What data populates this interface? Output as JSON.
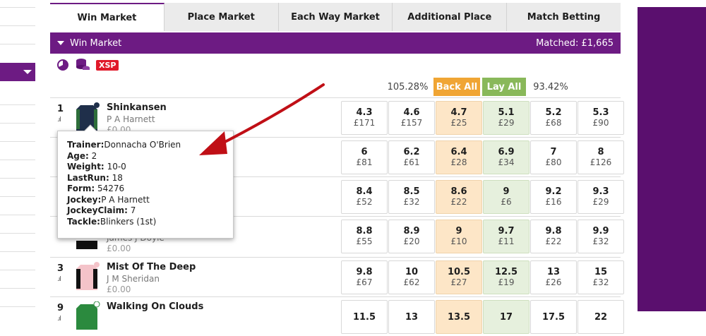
{
  "tabs": [
    "Win Market",
    "Place Market",
    "Each Way Market",
    "Additional Place",
    "Match Betting"
  ],
  "market": {
    "name": "Win Market",
    "matched": "Matched: £1,665"
  },
  "tools": {
    "xsp": "XSP"
  },
  "header": {
    "back_pct": "105.28%",
    "back_all": "Back All",
    "lay_all": "Lay All",
    "lay_pct": "93.42%"
  },
  "colors": {
    "brand": "#6d1b83",
    "back": "#f0a534",
    "lay": "#89b85a",
    "back_cell": "#fde6c7",
    "lay_cell": "#e6f0dd"
  },
  "runners": [
    {
      "num": "1",
      "name": "Shinkansen",
      "jockey": "P A Harnett",
      "pl": "£0.00",
      "silk": "navy-green",
      "prices": [
        [
          "4.3",
          "£171"
        ],
        [
          "4.6",
          "£157"
        ],
        [
          "4.7",
          "£25"
        ],
        [
          "5.1",
          "£29"
        ],
        [
          "5.2",
          "£68"
        ],
        [
          "5.3",
          "£90"
        ]
      ]
    },
    {
      "num": "",
      "name": "",
      "jockey": "",
      "pl": "",
      "silk": "none",
      "prices": [
        [
          "6",
          "£81"
        ],
        [
          "6.2",
          "£61"
        ],
        [
          "6.4",
          "£28"
        ],
        [
          "6.9",
          "£34"
        ],
        [
          "7",
          "£80"
        ],
        [
          "8",
          "£126"
        ]
      ]
    },
    {
      "num": "",
      "name": "",
      "jockey": "",
      "pl": "",
      "silk": "none",
      "prices": [
        [
          "8.4",
          "£52"
        ],
        [
          "8.5",
          "£32"
        ],
        [
          "8.6",
          "£22"
        ],
        [
          "9",
          "£6"
        ],
        [
          "9.2",
          "£16"
        ],
        [
          "9.3",
          "£29"
        ]
      ]
    },
    {
      "num": "",
      "name": "",
      "jockey": "James J Doyle",
      "pl": "£0.00",
      "silk": "black",
      "prices": [
        [
          "8.8",
          "£55"
        ],
        [
          "8.9",
          "£20"
        ],
        [
          "9",
          "£10"
        ],
        [
          "9.7",
          "£11"
        ],
        [
          "9.8",
          "£22"
        ],
        [
          "9.9",
          "£32"
        ]
      ]
    },
    {
      "num": "3",
      "name": "Mist Of The Deep",
      "jockey": "J M Sheridan",
      "pl": "£0.00",
      "silk": "pink-black",
      "prices": [
        [
          "9.8",
          "£67"
        ],
        [
          "10",
          "£62"
        ],
        [
          "10.5",
          "£27"
        ],
        [
          "12.5",
          "£19"
        ],
        [
          "13",
          "£26"
        ],
        [
          "15",
          "£32"
        ]
      ]
    },
    {
      "num": "9",
      "name": "Walking On Clouds",
      "jockey": "",
      "pl": "",
      "silk": "green",
      "prices": [
        [
          "11.5",
          ""
        ],
        [
          "13",
          ""
        ],
        [
          "13.5",
          ""
        ],
        [
          "17",
          ""
        ],
        [
          "17.5",
          ""
        ],
        [
          "22",
          ""
        ]
      ]
    }
  ],
  "tooltip": {
    "trainer_label": "Trainer:",
    "trainer": "Donnacha O'Brien",
    "age_label": "Age:",
    "age": "2",
    "weight_label": "Weight:",
    "weight": "10-0",
    "lastrun_label": "LastRun:",
    "lastrun": "18",
    "form_label": "Form:",
    "form": "54276",
    "jockey_label": "Jockey:",
    "jockey": "P A Harnett",
    "claim_label": "JockeyClaim:",
    "claim": "7",
    "tackle_label": "Tackle:",
    "tackle": "Blinkers (1st)"
  }
}
